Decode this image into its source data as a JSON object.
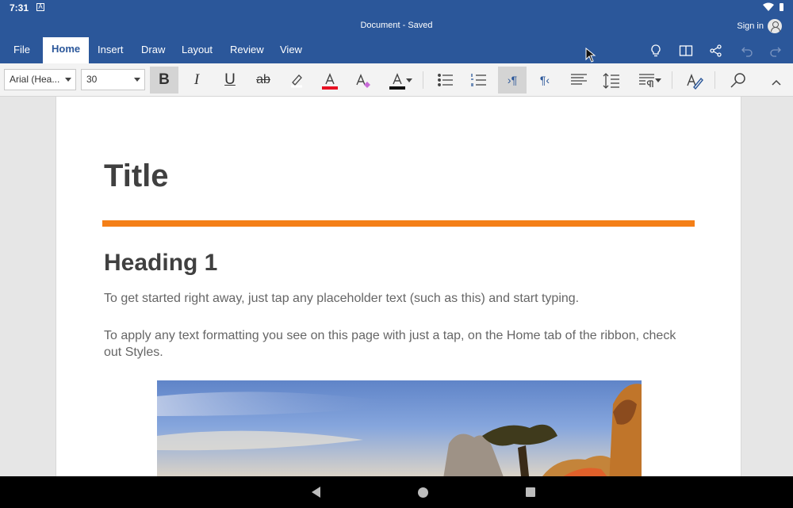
{
  "status": {
    "time": "7:31",
    "notif_glyph": "A"
  },
  "titlebar": {
    "doc_title": "Document - Saved",
    "signin": "Sign in"
  },
  "tabs": [
    {
      "label": "File",
      "active": false
    },
    {
      "label": "Home",
      "active": true
    },
    {
      "label": "Insert",
      "active": false
    },
    {
      "label": "Draw",
      "active": false
    },
    {
      "label": "Layout",
      "active": false
    },
    {
      "label": "Review",
      "active": false
    },
    {
      "label": "View",
      "active": false
    }
  ],
  "title_icons": [
    "lightbulb-icon",
    "reading-view-icon",
    "share-icon",
    "undo-icon",
    "redo-icon"
  ],
  "ribbon": {
    "font_name": "Arial (Hea...",
    "font_size": "30",
    "bold": "B",
    "italic": "I",
    "underline": "U",
    "strike": "ab",
    "ltr_label": "›¶",
    "rtl_label": "¶‹"
  },
  "document": {
    "title": "Title",
    "heading": "Heading 1",
    "para1": "To get started right away, just tap any placeholder text (such as this) and start typing.",
    "para2": "To apply any text formatting you see on this page with just a tap, on the Home tab of the ribbon, check out Styles."
  },
  "colors": {
    "brand": "#2b579a",
    "accent_rule": "#f47f17",
    "font_color": "#e81123",
    "highlight": "#ffffff"
  }
}
